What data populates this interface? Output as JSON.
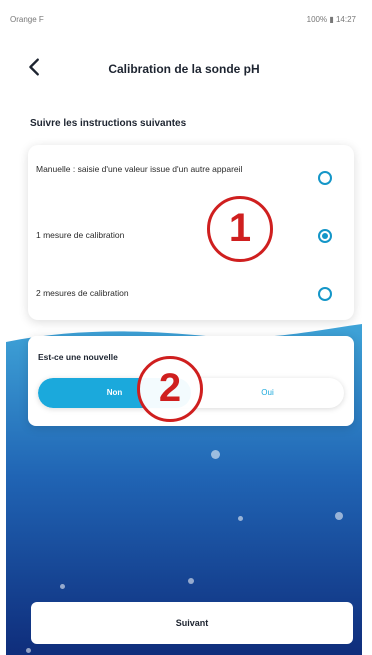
{
  "status_bar": {
    "carrier": "Orange F",
    "right": "100%",
    "time": "14:27"
  },
  "header": {
    "title": "Calibration de la sonde pH"
  },
  "instructions": {
    "title": "Suivre les instructions suivantes",
    "options": [
      {
        "label": "Manuelle : saisie d'une valeur issue d'un autre appareil",
        "selected": false
      },
      {
        "label": "1 mesure de calibration",
        "selected": true
      },
      {
        "label": "2 mesures de calibration",
        "selected": false
      }
    ]
  },
  "question": {
    "text": "Est-ce une nouvelle",
    "no_label": "Non",
    "yes_label": "Oui",
    "selected": "Non"
  },
  "markers": {
    "one": "1",
    "two": "2"
  },
  "footer": {
    "next_label": "Suivant"
  },
  "colors": {
    "accent": "#1ba9dc",
    "marker": "#cf1f1f",
    "wave_top": "#3fa4d8",
    "wave_bottom": "#0e2a78"
  }
}
